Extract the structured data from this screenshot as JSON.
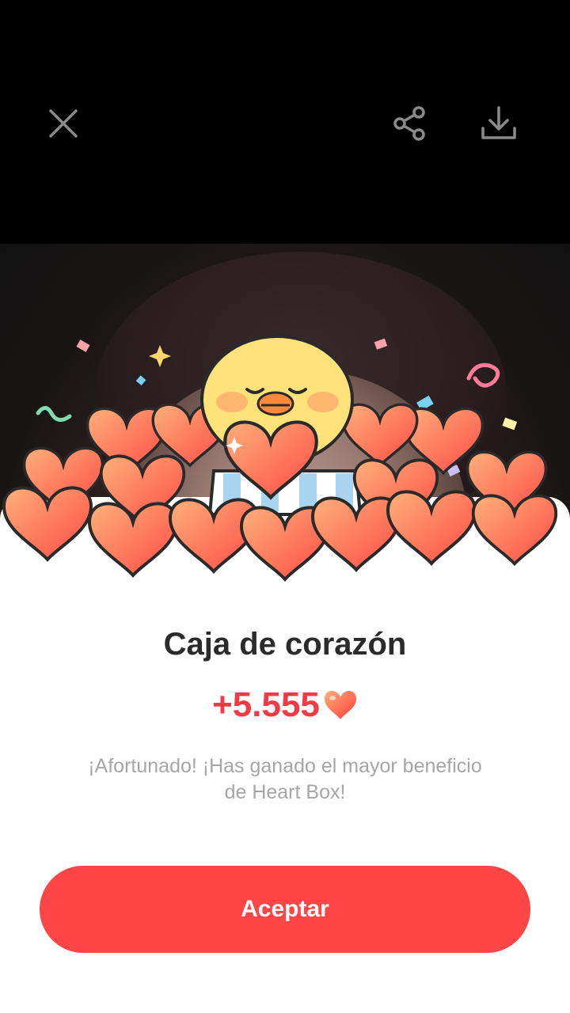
{
  "toolbar": {
    "close_icon": "close-icon",
    "share_icon": "share-icon",
    "download_icon": "download-icon"
  },
  "reward": {
    "title": "Caja de corazón",
    "amount": "+5.555",
    "amount_icon": "heart-icon",
    "description": "¡Afortunado! ¡Has ganado el mayor beneficio de Heart Box!",
    "accept_label": "Aceptar"
  },
  "colors": {
    "accent": "#ff4545",
    "amount": "#f23b45",
    "title": "#2b2b2b",
    "description": "#a6a6a6"
  }
}
